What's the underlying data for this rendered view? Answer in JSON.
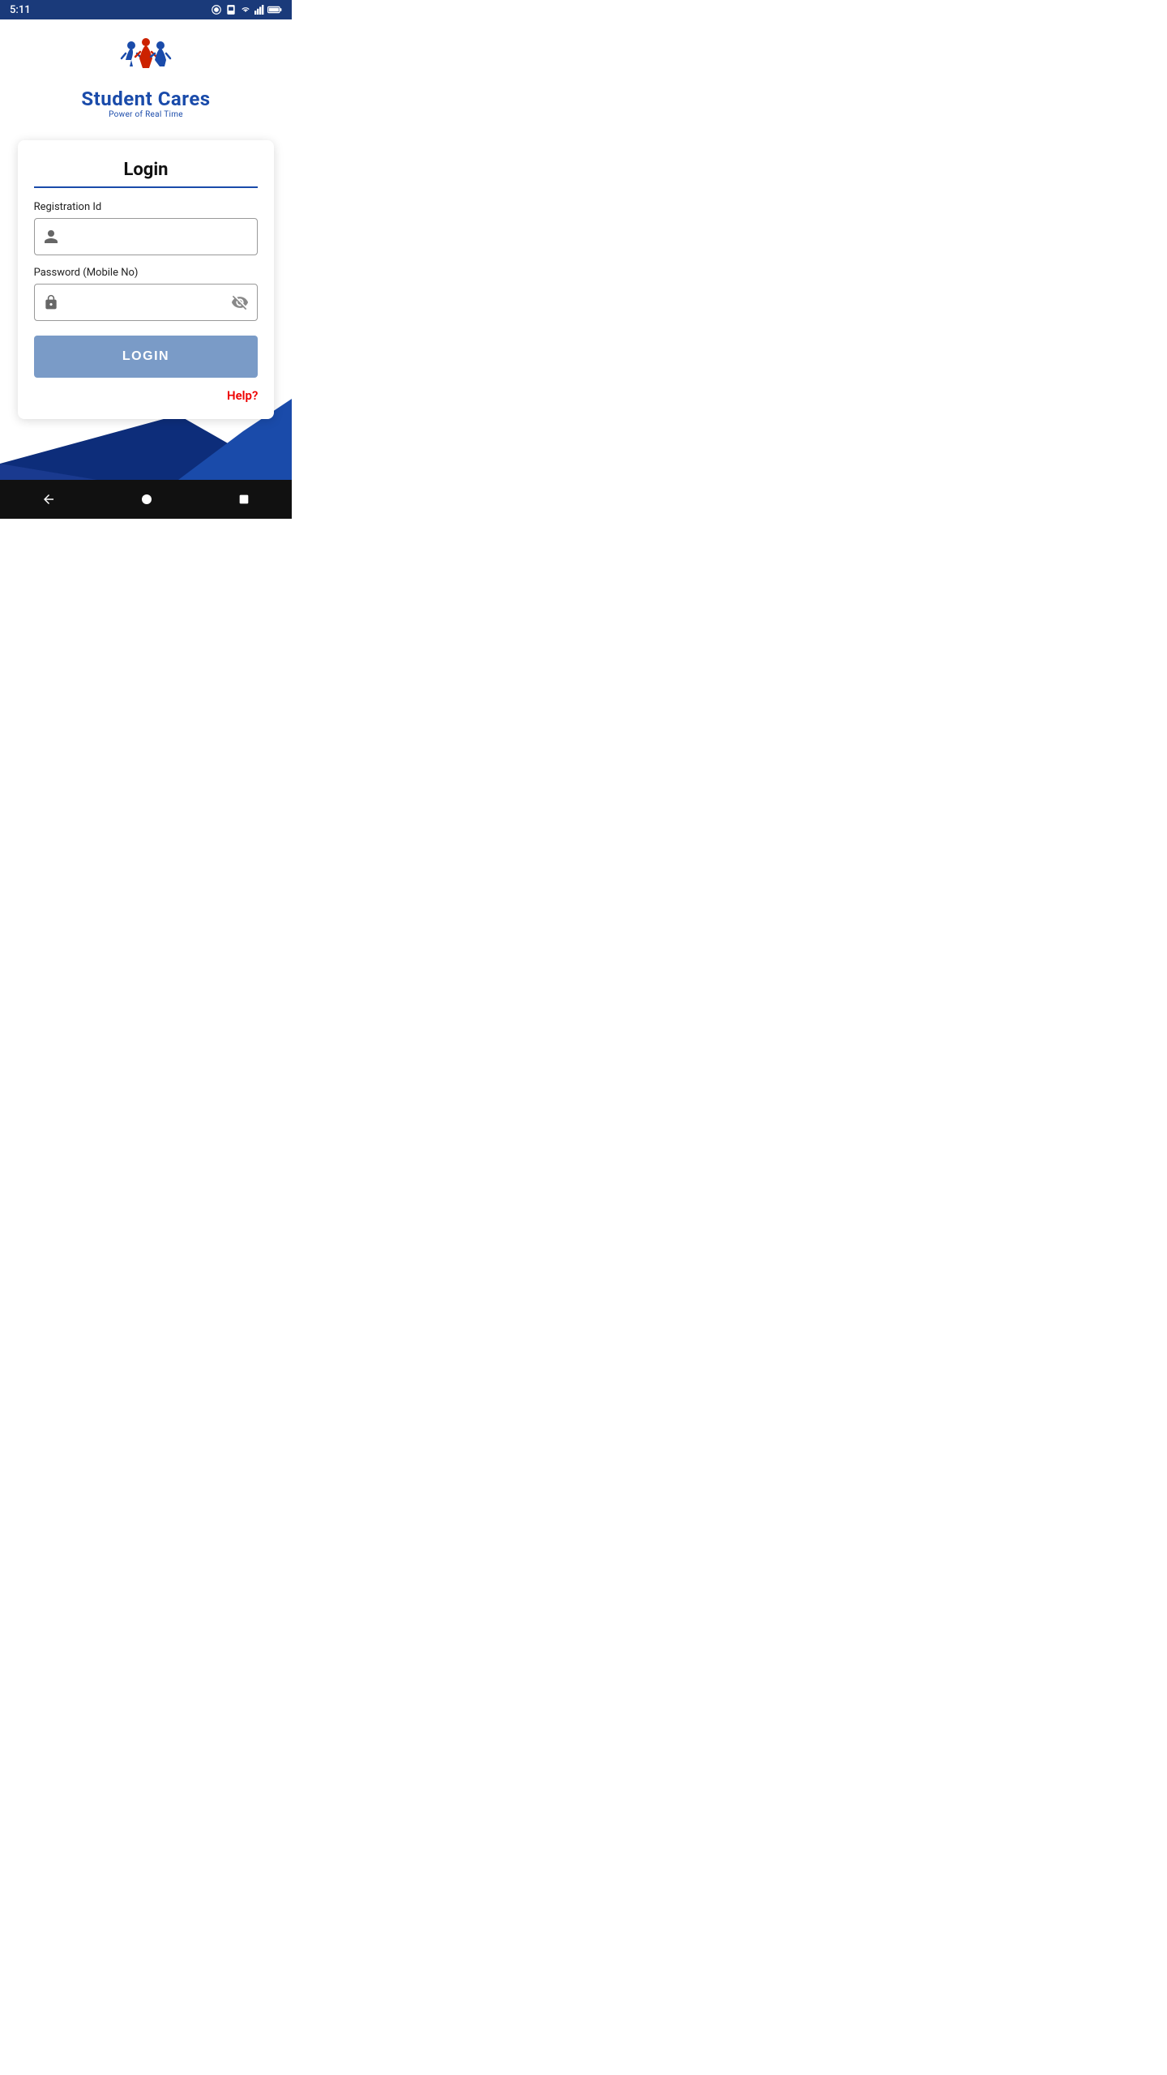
{
  "statusBar": {
    "time": "5:11",
    "icons": [
      "notification-icon",
      "sim-icon",
      "wifi-icon",
      "signal-icon",
      "battery-icon"
    ]
  },
  "logo": {
    "appName": "Student Cares",
    "tagline": "Power of Real Time"
  },
  "loginCard": {
    "title": "Login",
    "registrationLabel": "Registration Id",
    "registrationPlaceholder": "",
    "passwordLabel": "Password (Mobile No)",
    "passwordPlaceholder": "",
    "loginButtonLabel": "LOGIN",
    "helpLabel": "Help?"
  },
  "bottomNav": {
    "backLabel": "◀",
    "homeLabel": "●",
    "recentLabel": "■"
  },
  "colors": {
    "primary": "#1a4baa",
    "buttonBg": "#7a9bc7",
    "helpColor": "#cc0000",
    "backgroundBlue": "#0d2d7a"
  }
}
